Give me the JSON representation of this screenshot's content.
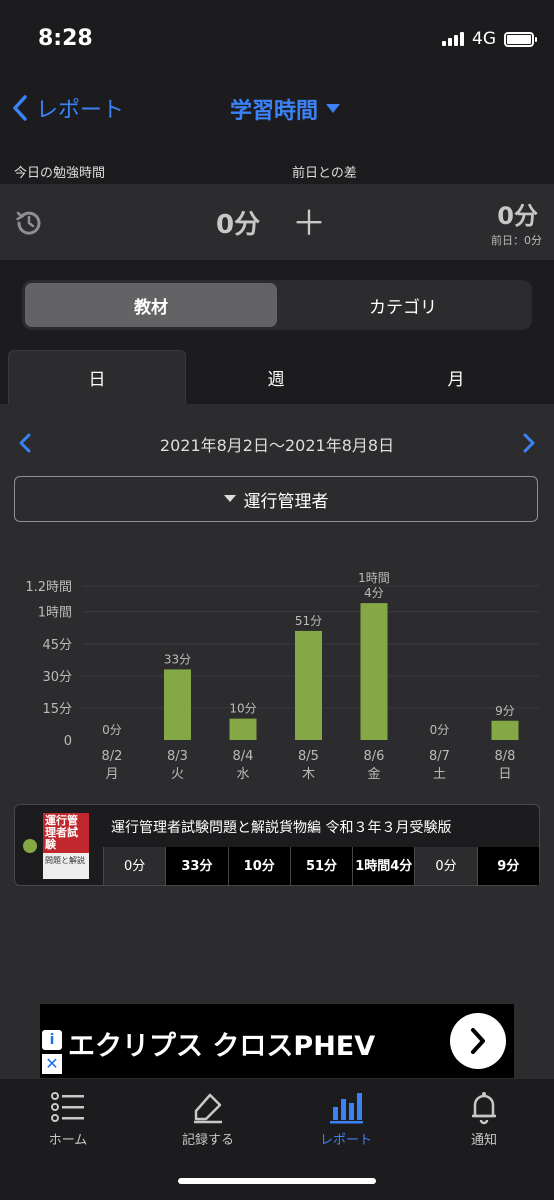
{
  "status_bar": {
    "time": "8:28",
    "network": "4G"
  },
  "nav": {
    "back_label": "レポート",
    "title": "学習時間"
  },
  "today": {
    "label_today": "今日の勉強時間",
    "label_diff": "前日との差",
    "today_value": "0分",
    "plus_sign": "＋",
    "diff_value": "0分",
    "previous_day": "前日：0分"
  },
  "segment": {
    "items": [
      "教材",
      "カテゴリ"
    ],
    "selected": "教材"
  },
  "period_tabs": {
    "items": [
      "日",
      "週",
      "月"
    ],
    "selected": "日"
  },
  "date_range": "2021年8月2日〜2021年8月8日",
  "category_filter": "運行管理者",
  "chart_data": {
    "type": "bar",
    "categories": [
      "8/2 月",
      "8/3 火",
      "8/4 水",
      "8/5 木",
      "8/6 金",
      "8/7 土",
      "8/8 日"
    ],
    "dates": [
      "8/2",
      "8/3",
      "8/4",
      "8/5",
      "8/6",
      "8/7",
      "8/8"
    ],
    "weekdays": [
      "月",
      "火",
      "水",
      "木",
      "金",
      "土",
      "日"
    ],
    "values": [
      0,
      33,
      10,
      51,
      64,
      0,
      9
    ],
    "value_labels": [
      "0分",
      "33分",
      "10分",
      "51分",
      "1時間\n4分",
      "0分",
      "9分"
    ],
    "yticks": [
      0,
      15,
      30,
      45,
      60,
      72
    ],
    "ytick_labels": [
      "0",
      "15分",
      "30分",
      "45分",
      "1時間",
      "1.2時間"
    ],
    "ylim": [
      0,
      72
    ],
    "bar_color": "#84a844"
  },
  "legend": {
    "book_title": "運行管理者試験問題と解説貨物編 令和３年３月受験版",
    "book_cover_text": "運行管理者試験",
    "book_cover_sub": "問題と解説",
    "color": "#84a844",
    "daily": [
      "0分",
      "33分",
      "10分",
      "51分",
      "1時間\n4分",
      "0分",
      "9分"
    ]
  },
  "ad": {
    "text": "エクリプス クロスPHEV"
  },
  "tabbar": {
    "items": [
      {
        "label": "ホーム",
        "icon": "list-icon"
      },
      {
        "label": "記録する",
        "icon": "pencil-icon"
      },
      {
        "label": "レポート",
        "icon": "bar-chart-icon"
      },
      {
        "label": "通知",
        "icon": "bell-icon"
      }
    ],
    "selected": "レポート"
  },
  "colors": {
    "accent": "#3b82f6",
    "bar": "#84a844"
  }
}
